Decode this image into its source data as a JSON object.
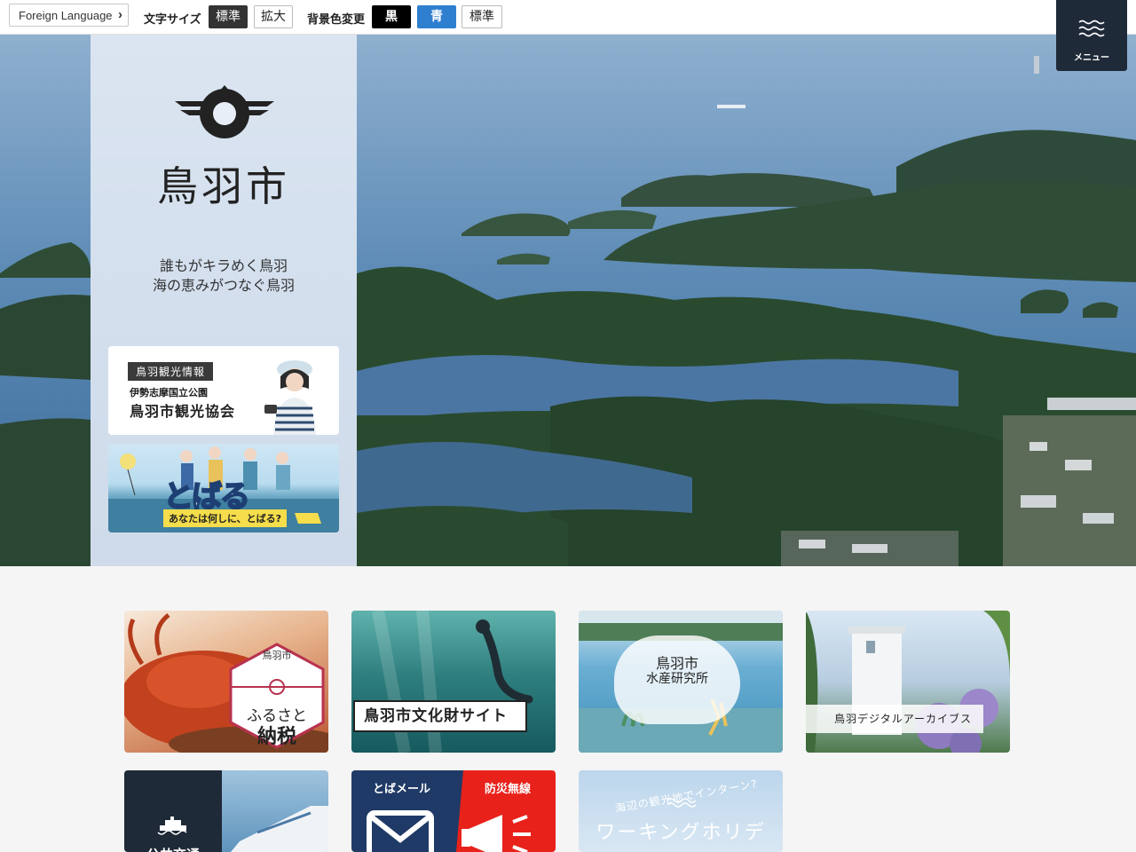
{
  "topbar": {
    "foreign_language": "Foreign Language",
    "font_size_label": "文字サイズ",
    "font_size_standard": "標準",
    "font_size_large": "拡大",
    "bg_color_label": "背景色変更",
    "bg_black": "黒",
    "bg_blue": "青",
    "bg_standard": "標準"
  },
  "menu": {
    "label": "メニュー"
  },
  "brand": {
    "city_name": "鳥羽市",
    "slogan_line1": "誰もがキラめく鳥羽",
    "slogan_line2": "海の恵みがつなぐ鳥羽"
  },
  "banners": {
    "tourism_tag": "鳥羽観光情報",
    "tourism_sub": "伊勢志摩国立公園",
    "tourism_main": "鳥羽市観光協会",
    "tobaru_logo": "とばる",
    "tobaru_caption": "あなたは何しに、とばる?"
  },
  "tiles": {
    "furusato_small": "鳥羽市",
    "furusato_line1": "ふるさと",
    "furusato_line2": "納税",
    "bunkazai": "鳥羽市文化財サイト",
    "suisan_line1": "鳥羽市",
    "suisan_line2": "水産研究所",
    "archive": "鳥羽デジタルアーカイブス",
    "transport": "公共交通",
    "toba_mail": "とばメール",
    "bousai": "防災無線",
    "holiday_arc": "海辺の観光地でインターン?",
    "holiday_title": "ワーキングホリデー"
  },
  "colors": {
    "menu_bg": "#1f2a38",
    "blue_button": "#2f7fd0",
    "alert_red": "#e8221b",
    "navy": "#1f3a66"
  }
}
